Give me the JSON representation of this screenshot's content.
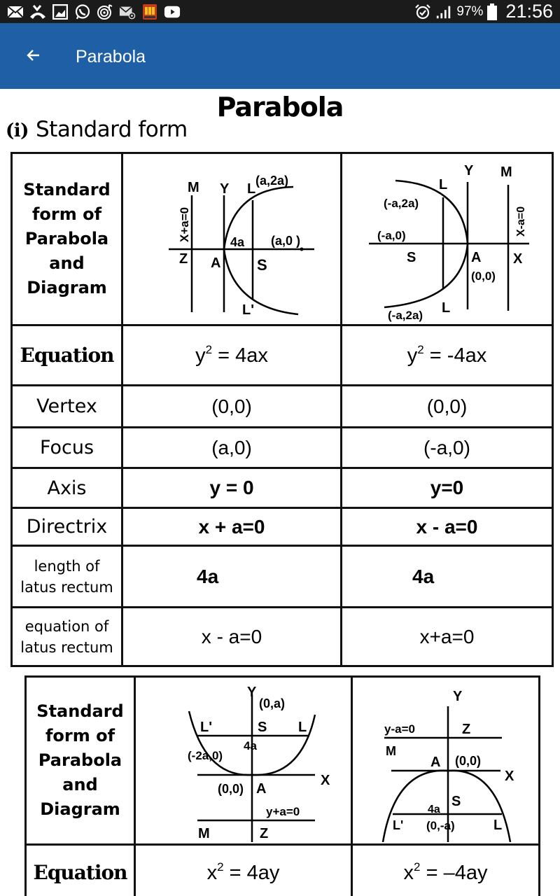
{
  "status_bar": {
    "left_icons": [
      "email-icon",
      "missed-call-icon",
      "gallery-icon",
      "whatsapp-icon",
      "music-player-icon",
      "email-at-icon",
      "news-app-icon",
      "youtube-icon"
    ],
    "right_icons": [
      "alarm-icon",
      "signal-icon",
      "battery-icon"
    ],
    "battery_percent": "97%",
    "time": "21:56"
  },
  "app_bar": {
    "back_icon": "arrow-back-icon",
    "title": "Parabola"
  },
  "document": {
    "title": "Parabola",
    "section_number": "(i)",
    "section_title": "Standard form",
    "table1": {
      "diagram_row_label": [
        "Standard",
        "form of",
        "Parabola",
        "and",
        "Diagram"
      ],
      "diagram_right": {
        "labels": {
          "directrix": "X+a=0",
          "M": "M",
          "Y": "Y",
          "L": "L",
          "L_coord": "(a,2a)",
          "latus": "4a",
          "focus_coord": "(a,0 )",
          "Z": "Z",
          "A": "A",
          "S": "S",
          "L_prime": "L'"
        }
      },
      "diagram_left": {
        "labels": {
          "Y": "Y",
          "M": "M",
          "L_top": "L",
          "L_top_coord": "(-a,2a)",
          "focus_coord": "(-a,0)",
          "directrix": "X-a=0",
          "S": "S",
          "A": "A",
          "X": "X",
          "vertex": "(0,0)",
          "L_bottom": "L",
          "L_bottom_coord": "(-a,2a)"
        }
      },
      "rows": [
        {
          "label": "Equation",
          "col1": {
            "base": "y",
            "sup": "2",
            "rest": " = 4ax"
          },
          "col2": {
            "base": "y",
            "sup": "2",
            "rest": " = -4ax"
          }
        },
        {
          "label": "Vertex",
          "col1": "(0,0)",
          "col2": "(0,0)"
        },
        {
          "label": "Focus",
          "col1": "(a,0)",
          "col2": "(-a,0)"
        },
        {
          "label": "Axis",
          "col1": "y = 0",
          "col2": "y=0"
        },
        {
          "label": "Directrix",
          "col1": "x + a=0",
          "col2": "x - a=0"
        },
        {
          "label": [
            "length of",
            "latus rectum"
          ],
          "col1": "4a",
          "col2": "4a"
        },
        {
          "label": [
            "equation of",
            "latus rectum"
          ],
          "col1": "x - a=0",
          "col2": "x+a=0"
        }
      ]
    },
    "table2": {
      "diagram_row_label": [
        "Standard",
        "form of",
        "Parabola",
        "and",
        "Diagram"
      ],
      "diagram_up": {
        "labels": {
          "Y": "Y",
          "focus_coord": "(0,a)",
          "L_prime": "L'",
          "S": "S",
          "L": "L",
          "latus_coord": "(-2a,0)",
          "latus": "4a",
          "X": "X",
          "vertex": "(0,0)",
          "A": "A",
          "directrix": "y+a=0",
          "M": "M",
          "Z": "Z"
        }
      },
      "diagram_down": {
        "labels": {
          "Y": "Y",
          "directrix": "y-a=0",
          "Z": "Z",
          "M": "M",
          "A": "A",
          "vertex": "(0,0)",
          "X": "X",
          "S": "S",
          "latus": "4a",
          "L_prime": "L'",
          "focus_coord": "(0,-a)",
          "L": "L"
        }
      },
      "rows": [
        {
          "label": "Equation",
          "col1": {
            "base": "x",
            "sup": "2",
            "rest": " = 4ay"
          },
          "col2": {
            "base": "x",
            "sup": "2",
            "rest": " = –4ay"
          }
        }
      ]
    }
  }
}
